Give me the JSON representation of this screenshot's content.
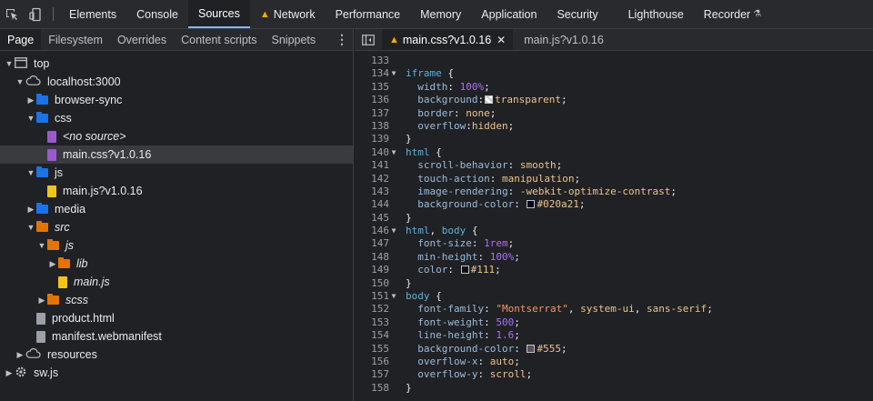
{
  "colors": {
    "accent": "#8ab4f8",
    "folder_blue": "#1a73e8",
    "folder_orange": "#e37400",
    "file_purple": "#9b59d0",
    "file_yellow": "#f0c419",
    "warning": "#f9ab00"
  },
  "toolbar": {
    "icons": [
      "inspect-element-icon",
      "device-toolbar-icon"
    ],
    "tabs": [
      {
        "label": "Elements",
        "active": false
      },
      {
        "label": "Console",
        "active": false
      },
      {
        "label": "Sources",
        "active": true
      },
      {
        "label": "Network",
        "active": false,
        "warning": true
      },
      {
        "label": "Performance",
        "active": false
      },
      {
        "label": "Memory",
        "active": false
      },
      {
        "label": "Application",
        "active": false
      },
      {
        "label": "Security",
        "active": false
      },
      {
        "label": "Lighthouse",
        "active": false
      },
      {
        "label": "Recorder",
        "active": false,
        "experimental": true
      }
    ]
  },
  "navigator": {
    "tabs": [
      {
        "label": "Page",
        "active": true
      },
      {
        "label": "Filesystem",
        "active": false
      },
      {
        "label": "Overrides",
        "active": false
      },
      {
        "label": "Content scripts",
        "active": false
      },
      {
        "label": "Snippets",
        "active": false
      }
    ],
    "tree": [
      {
        "label": "top",
        "depth": 0,
        "arrow": "down",
        "icon": "frame-icon"
      },
      {
        "label": "localhost:3000",
        "depth": 1,
        "arrow": "down",
        "icon": "cloud-icon"
      },
      {
        "label": "browser-sync",
        "depth": 2,
        "arrow": "right",
        "icon": "folder-icon",
        "color": "blue"
      },
      {
        "label": "css",
        "depth": 2,
        "arrow": "down",
        "icon": "folder-icon",
        "color": "blue"
      },
      {
        "label": "<no source>",
        "depth": 3,
        "arrow": "",
        "icon": "file-icon",
        "color": "purple",
        "italic": true
      },
      {
        "label": "main.css?v1.0.16",
        "depth": 3,
        "arrow": "",
        "icon": "file-icon",
        "color": "purple",
        "selected": true
      },
      {
        "label": "js",
        "depth": 2,
        "arrow": "down",
        "icon": "folder-icon",
        "color": "blue"
      },
      {
        "label": "main.js?v1.0.16",
        "depth": 3,
        "arrow": "",
        "icon": "file-icon",
        "color": "yellow"
      },
      {
        "label": "media",
        "depth": 2,
        "arrow": "right",
        "icon": "folder-icon",
        "color": "blue"
      },
      {
        "label": "src",
        "depth": 2,
        "arrow": "down",
        "icon": "folder-icon",
        "color": "orange",
        "italic": true
      },
      {
        "label": "js",
        "depth": 3,
        "arrow": "down",
        "icon": "folder-icon",
        "color": "orange",
        "italic": true
      },
      {
        "label": "lib",
        "depth": 4,
        "arrow": "right",
        "icon": "folder-icon",
        "color": "orange",
        "italic": true
      },
      {
        "label": "main.js",
        "depth": 4,
        "arrow": "",
        "icon": "file-icon",
        "color": "yellow",
        "italic": true
      },
      {
        "label": "scss",
        "depth": 3,
        "arrow": "right",
        "icon": "folder-icon",
        "color": "orange",
        "italic": true
      },
      {
        "label": "product.html",
        "depth": 2,
        "arrow": "",
        "icon": "file-icon",
        "color": "gray"
      },
      {
        "label": "manifest.webmanifest",
        "depth": 2,
        "arrow": "",
        "icon": "file-icon",
        "color": "gray"
      },
      {
        "label": "resources",
        "depth": 1,
        "arrow": "right",
        "icon": "cloud-icon"
      },
      {
        "label": "sw.js",
        "depth": 0,
        "arrow": "right",
        "icon": "gear-icon"
      }
    ]
  },
  "editor": {
    "tabs": [
      {
        "label": "main.css?v1.0.16",
        "active": true,
        "warning": true,
        "closable": true
      },
      {
        "label": "main.js?v1.0.16",
        "active": false
      }
    ],
    "lines": [
      {
        "n": "133",
        "fold": false,
        "segs": []
      },
      {
        "n": "134",
        "fold": true,
        "segs": [
          {
            "c": "sel",
            "t": "iframe"
          },
          {
            "c": "",
            "t": " {"
          }
        ]
      },
      {
        "n": "135",
        "fold": false,
        "segs": [
          {
            "c": "",
            "t": "  "
          },
          {
            "c": "prop",
            "t": "width"
          },
          {
            "c": "",
            "t": ": "
          },
          {
            "c": "num",
            "t": "100%"
          },
          {
            "c": "",
            "t": ";"
          }
        ]
      },
      {
        "n": "136",
        "fold": false,
        "segs": [
          {
            "c": "",
            "t": "  "
          },
          {
            "c": "prop",
            "t": "background"
          },
          {
            "c": "",
            "t": ":"
          },
          {
            "swatch": "transparent"
          },
          {
            "c": "val",
            "t": "transparent"
          },
          {
            "c": "",
            "t": ";"
          }
        ]
      },
      {
        "n": "137",
        "fold": false,
        "segs": [
          {
            "c": "",
            "t": "  "
          },
          {
            "c": "prop",
            "t": "border"
          },
          {
            "c": "",
            "t": ": "
          },
          {
            "c": "val",
            "t": "none"
          },
          {
            "c": "",
            "t": ";"
          }
        ]
      },
      {
        "n": "138",
        "fold": false,
        "segs": [
          {
            "c": "",
            "t": "  "
          },
          {
            "c": "prop",
            "t": "overflow"
          },
          {
            "c": "",
            "t": ":"
          },
          {
            "c": "val",
            "t": "hidden"
          },
          {
            "c": "",
            "t": ";"
          }
        ]
      },
      {
        "n": "139",
        "fold": false,
        "segs": [
          {
            "c": "",
            "t": "}"
          }
        ]
      },
      {
        "n": "140",
        "fold": true,
        "segs": [
          {
            "c": "sel",
            "t": "html"
          },
          {
            "c": "",
            "t": " {"
          }
        ]
      },
      {
        "n": "141",
        "fold": false,
        "segs": [
          {
            "c": "",
            "t": "  "
          },
          {
            "c": "prop",
            "t": "scroll-behavior"
          },
          {
            "c": "",
            "t": ": "
          },
          {
            "c": "val",
            "t": "smooth"
          },
          {
            "c": "",
            "t": ";"
          }
        ]
      },
      {
        "n": "142",
        "fold": false,
        "segs": [
          {
            "c": "",
            "t": "  "
          },
          {
            "c": "prop",
            "t": "touch-action"
          },
          {
            "c": "",
            "t": ": "
          },
          {
            "c": "val",
            "t": "manipulation"
          },
          {
            "c": "",
            "t": ";"
          }
        ]
      },
      {
        "n": "143",
        "fold": false,
        "segs": [
          {
            "c": "",
            "t": "  "
          },
          {
            "c": "prop",
            "t": "image-rendering"
          },
          {
            "c": "",
            "t": ": "
          },
          {
            "c": "val",
            "t": "-webkit-optimize-contrast"
          },
          {
            "c": "",
            "t": ";"
          }
        ]
      },
      {
        "n": "144",
        "fold": false,
        "segs": [
          {
            "c": "",
            "t": "  "
          },
          {
            "c": "prop",
            "t": "background-color"
          },
          {
            "c": "",
            "t": ": "
          },
          {
            "swatch": "#020a21"
          },
          {
            "c": "val",
            "t": "#020a21"
          },
          {
            "c": "",
            "t": ";"
          }
        ]
      },
      {
        "n": "145",
        "fold": false,
        "segs": [
          {
            "c": "",
            "t": "}"
          }
        ]
      },
      {
        "n": "146",
        "fold": true,
        "segs": [
          {
            "c": "sel",
            "t": "html"
          },
          {
            "c": "",
            "t": ", "
          },
          {
            "c": "sel",
            "t": "body"
          },
          {
            "c": "",
            "t": " {"
          }
        ]
      },
      {
        "n": "147",
        "fold": false,
        "segs": [
          {
            "c": "",
            "t": "  "
          },
          {
            "c": "prop",
            "t": "font-size"
          },
          {
            "c": "",
            "t": ": "
          },
          {
            "c": "num",
            "t": "1rem"
          },
          {
            "c": "",
            "t": ";"
          }
        ]
      },
      {
        "n": "148",
        "fold": false,
        "segs": [
          {
            "c": "",
            "t": "  "
          },
          {
            "c": "prop",
            "t": "min-height"
          },
          {
            "c": "",
            "t": ": "
          },
          {
            "c": "num",
            "t": "100%"
          },
          {
            "c": "",
            "t": ";"
          }
        ]
      },
      {
        "n": "149",
        "fold": false,
        "segs": [
          {
            "c": "",
            "t": "  "
          },
          {
            "c": "prop",
            "t": "color"
          },
          {
            "c": "",
            "t": ": "
          },
          {
            "swatch": "#111"
          },
          {
            "c": "val",
            "t": "#111"
          },
          {
            "c": "",
            "t": ";"
          }
        ]
      },
      {
        "n": "150",
        "fold": false,
        "segs": [
          {
            "c": "",
            "t": "}"
          }
        ]
      },
      {
        "n": "151",
        "fold": true,
        "segs": [
          {
            "c": "sel",
            "t": "body"
          },
          {
            "c": "",
            "t": " {"
          }
        ]
      },
      {
        "n": "152",
        "fold": false,
        "segs": [
          {
            "c": "",
            "t": "  "
          },
          {
            "c": "prop",
            "t": "font-family"
          },
          {
            "c": "",
            "t": ": "
          },
          {
            "c": "str",
            "t": "\"Montserrat\""
          },
          {
            "c": "",
            "t": ", "
          },
          {
            "c": "val",
            "t": "system-ui"
          },
          {
            "c": "",
            "t": ", "
          },
          {
            "c": "val",
            "t": "sans-serif"
          },
          {
            "c": "",
            "t": ";"
          }
        ]
      },
      {
        "n": "153",
        "fold": false,
        "segs": [
          {
            "c": "",
            "t": "  "
          },
          {
            "c": "prop",
            "t": "font-weight"
          },
          {
            "c": "",
            "t": ": "
          },
          {
            "c": "num",
            "t": "500"
          },
          {
            "c": "",
            "t": ";"
          }
        ]
      },
      {
        "n": "154",
        "fold": false,
        "segs": [
          {
            "c": "",
            "t": "  "
          },
          {
            "c": "prop",
            "t": "line-height"
          },
          {
            "c": "",
            "t": ": "
          },
          {
            "c": "num",
            "t": "1.6"
          },
          {
            "c": "",
            "t": ";"
          }
        ]
      },
      {
        "n": "155",
        "fold": false,
        "segs": [
          {
            "c": "",
            "t": "  "
          },
          {
            "c": "prop",
            "t": "background-color"
          },
          {
            "c": "",
            "t": ": "
          },
          {
            "swatch": "#555"
          },
          {
            "c": "val",
            "t": "#555"
          },
          {
            "c": "",
            "t": ";"
          }
        ]
      },
      {
        "n": "156",
        "fold": false,
        "segs": [
          {
            "c": "",
            "t": "  "
          },
          {
            "c": "prop",
            "t": "overflow-x"
          },
          {
            "c": "",
            "t": ": "
          },
          {
            "c": "val",
            "t": "auto"
          },
          {
            "c": "",
            "t": ";"
          }
        ]
      },
      {
        "n": "157",
        "fold": false,
        "segs": [
          {
            "c": "",
            "t": "  "
          },
          {
            "c": "prop",
            "t": "overflow-y"
          },
          {
            "c": "",
            "t": ": "
          },
          {
            "c": "val",
            "t": "scroll"
          },
          {
            "c": "",
            "t": ";"
          }
        ]
      },
      {
        "n": "158",
        "fold": false,
        "segs": [
          {
            "c": "",
            "t": "}"
          }
        ]
      }
    ]
  }
}
